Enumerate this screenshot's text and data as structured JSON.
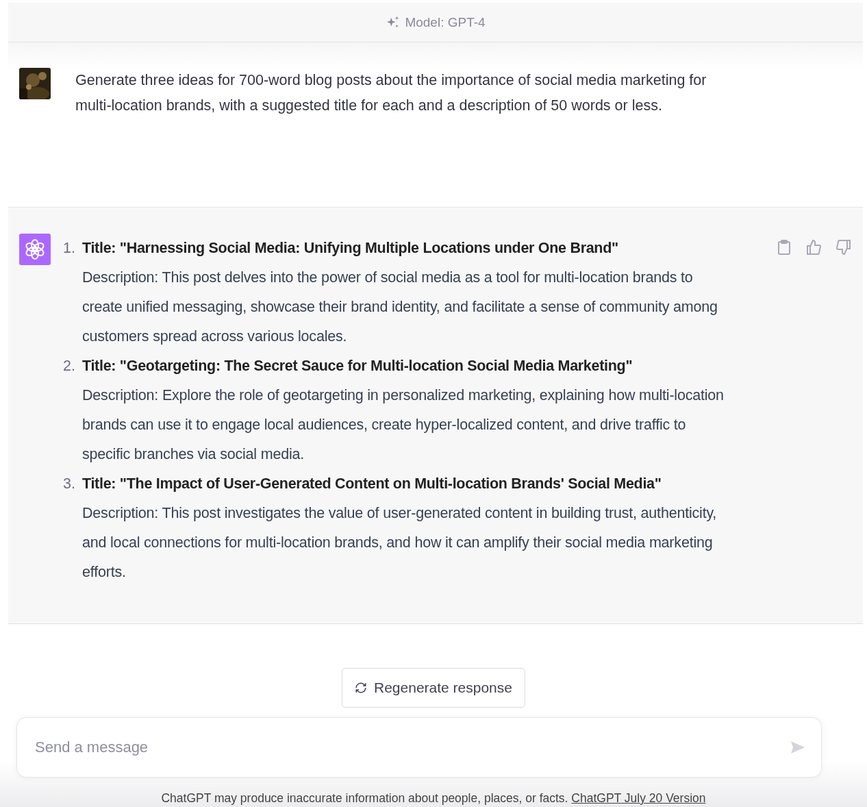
{
  "header": {
    "model_label": "Model: GPT-4"
  },
  "user_message": {
    "text": "Generate three ideas for 700-word blog posts about the importance of social media marketing for multi-location brands, with a suggested title for each and a description of 50 words or less."
  },
  "assistant_message": {
    "items": [
      {
        "number": "1.",
        "title": "Title: \"Harnessing Social Media: Unifying Multiple Locations under One Brand\"",
        "description": "Description: This post delves into the power of social media as a tool for multi-location brands to create unified messaging, showcase their brand identity, and facilitate a sense of community among customers spread across various locales."
      },
      {
        "number": "2.",
        "title": "Title: \"Geotargeting: The Secret Sauce for Multi-location Social Media Marketing\"",
        "description": "Description: Explore the role of geotargeting in personalized marketing, explaining how multi-location brands can use it to engage local audiences, create hyper-localized content, and drive traffic to specific branches via social media."
      },
      {
        "number": "3.",
        "title": "Title: \"The Impact of User-Generated Content on Multi-location Brands' Social Media\"",
        "description": "Description: This post investigates the value of user-generated content in building trust, authenticity, and local connections for multi-location brands, and how it can amplify their social media marketing efforts."
      }
    ]
  },
  "regenerate_button": {
    "label": "Regenerate response"
  },
  "composer": {
    "placeholder": "Send a message"
  },
  "footer": {
    "text": "ChatGPT may produce inaccurate information about people, places, or facts.",
    "link": "ChatGPT July 20 Version"
  }
}
